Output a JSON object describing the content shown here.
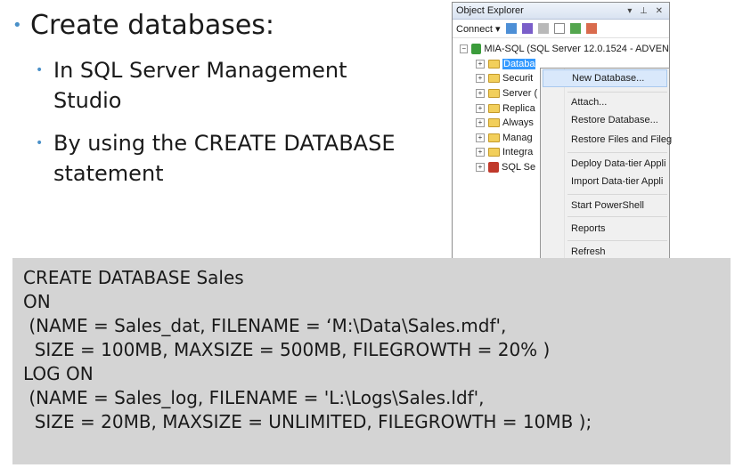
{
  "bullets": {
    "main": "Create databases:",
    "sub": [
      "In SQL Server Management Studio",
      "By using the CREATE DATABASE  statement"
    ]
  },
  "object_explorer": {
    "title": "Object Explorer",
    "connect": "Connect ▾",
    "server": "MIA-SQL (SQL Server 12.0.1524 - ADVEN",
    "nodes": [
      "Databa",
      "Securit",
      "Server (",
      "Replica",
      "Always",
      "Manag",
      "Integra",
      "SQL Se"
    ]
  },
  "context_menu": {
    "items": [
      "New Database...",
      "Attach...",
      "Restore Database...",
      "Restore Files and Fileg",
      "Deploy Data-tier Appli",
      "Import Data-tier Appli",
      "Start PowerShell",
      "Reports",
      "Refresh"
    ]
  },
  "code": [
    "CREATE DATABASE Sales",
    "ON",
    " (NAME = Sales_dat, FILENAME = ‘M:\\Data\\Sales.mdf',",
    "  SIZE = 100MB, MAXSIZE = 500MB, FILEGROWTH = 20% )",
    "LOG ON",
    " (NAME = Sales_log, FILENAME = 'L:\\Logs\\Sales.ldf',",
    "  SIZE = 20MB, MAXSIZE = UNLIMITED, FILEGROWTH = 10MB );"
  ]
}
